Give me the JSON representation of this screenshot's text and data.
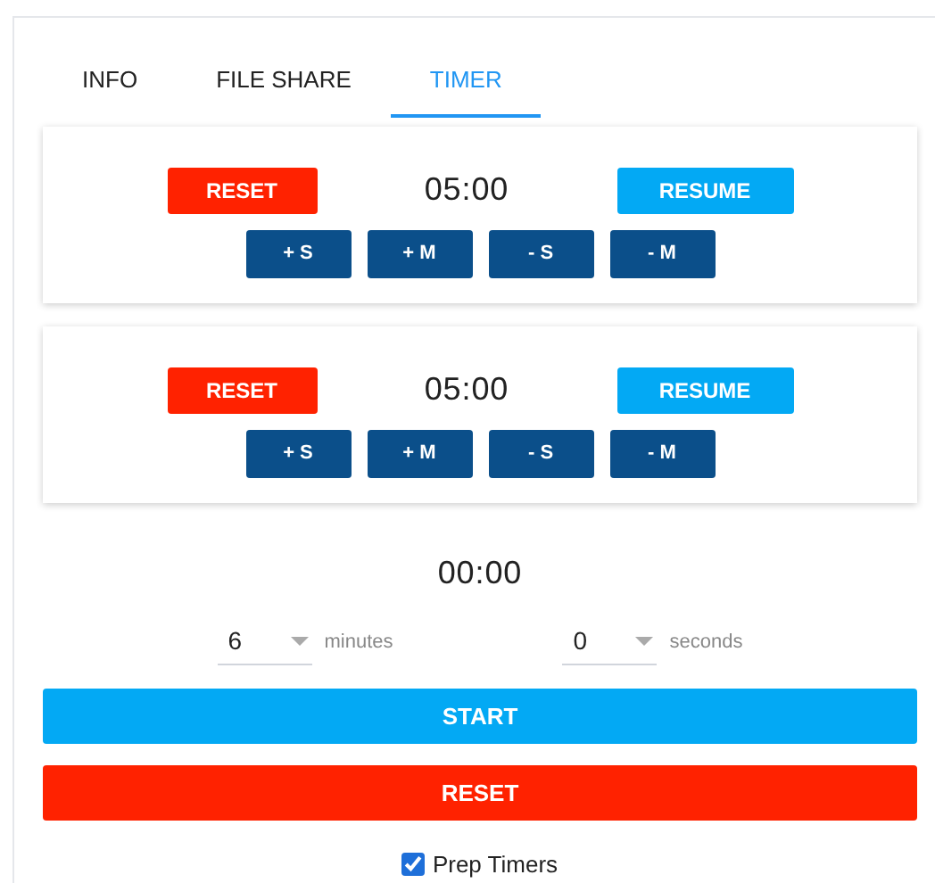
{
  "tabs": [
    {
      "label": "INFO",
      "selected": false
    },
    {
      "label": "FILE SHARE",
      "selected": false
    },
    {
      "label": "TIMER",
      "selected": true
    }
  ],
  "timers": [
    {
      "reset": "RESET",
      "time": "05:00",
      "resume": "RESUME",
      "adjust": [
        "+ S",
        "+ M",
        "- S",
        "- M"
      ]
    },
    {
      "reset": "RESET",
      "time": "05:00",
      "resume": "RESUME",
      "adjust": [
        "+ S",
        "+ M",
        "- S",
        "- M"
      ]
    }
  ],
  "main_time": "00:00",
  "minutes": {
    "value": "6",
    "unit": "minutes"
  },
  "seconds": {
    "value": "0",
    "unit": "seconds"
  },
  "start_button": "START",
  "reset_button": "RESET",
  "prep_timers": {
    "label": "Prep Timers",
    "checked": true
  }
}
